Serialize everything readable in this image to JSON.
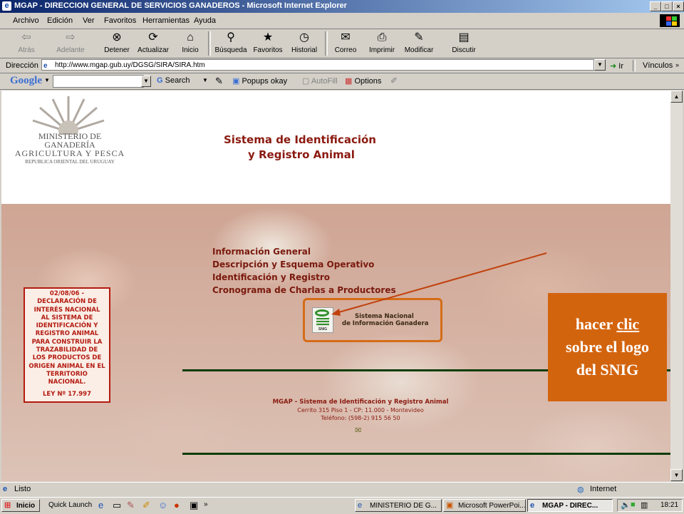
{
  "window": {
    "title": "MGAP - DIRECCION GENERAL DE SERVICIOS GANADEROS - Microsoft Internet Explorer"
  },
  "menu": [
    "Archivo",
    "Edición",
    "Ver",
    "Favoritos",
    "Herramientas",
    "Ayuda"
  ],
  "toolbar": {
    "back": "Atrás",
    "forward": "Adelante",
    "stop": "Detener",
    "refresh": "Actualizar",
    "home": "Inicio",
    "search": "Búsqueda",
    "favorites": "Favoritos",
    "history": "Historial",
    "mail": "Correo",
    "print": "Imprimir",
    "edit": "Modificar",
    "discuss": "Discutir"
  },
  "address": {
    "label": "Dirección",
    "url": "http://www.mgap.gub.uy/DGSG/SIRA/SIRA.htm",
    "go": "Ir",
    "links": "Vínculos"
  },
  "google": {
    "logo": "Google",
    "search": "Search",
    "popups": "Popups okay",
    "autofill": "AutoFill",
    "options": "Options"
  },
  "page": {
    "ministry_line1": "MINISTERIO DE GANADERÍA",
    "ministry_line2": "AGRICULTURA Y PESCA",
    "ministry_line3": "REPUBLICA ORIENTAL DEL URUGUAY",
    "title_line1": "Sistema de Identificación",
    "title_line2": "y Registro Animal",
    "links": [
      "Información General",
      "Descripción y Esquema Operativo",
      "Identificación y Registro",
      "Cronograma de Charlas a Productores"
    ],
    "declaration": [
      "02/08/06 -",
      "DECLARACIÓN DE",
      "INTERÉS NACIONAL",
      "AL SISTEMA DE",
      "IDENTIFICACIÓN Y",
      "REGISTRO ANIMAL",
      "PARA CONSTRUIR LA",
      "TRAZABILIDAD DE",
      "LOS PRODUCTOS DE",
      "ORIGEN ANIMAL EN EL",
      "TERRITORIO",
      "NACIONAL."
    ],
    "law": "LEY Nº 17.997",
    "snig_line1": "Sistema Nacional",
    "snig_line2": "de Información Ganadera",
    "snig_icon_label": "SNIG",
    "footer_title": "MGAP - Sistema de Identificación y Registro Animal",
    "footer_address": "Cerrito 315 Piso 1 - CP: 11.000 - Montevideo",
    "footer_phone": "Teléfono: (598-2) 915 56 50"
  },
  "callout": {
    "line1_prefix": "hacer ",
    "line1_link": "clic",
    "line2": "sobre el logo",
    "line3": "del SNIG"
  },
  "status": {
    "text": "Listo",
    "zone": "Internet"
  },
  "taskbar": {
    "start": "Inicio",
    "quick_launch": "Quick Launch",
    "tasks": [
      "MINISTERIO DE G...",
      "Microsoft PowerPoi...",
      "MGAP - DIREC..."
    ],
    "clock": "18:21"
  },
  "colors": {
    "callout": "#d3640e",
    "title_red": "#8b1a10",
    "highlight_box": "#d56c17",
    "footer_line": "#0d3d0a"
  }
}
